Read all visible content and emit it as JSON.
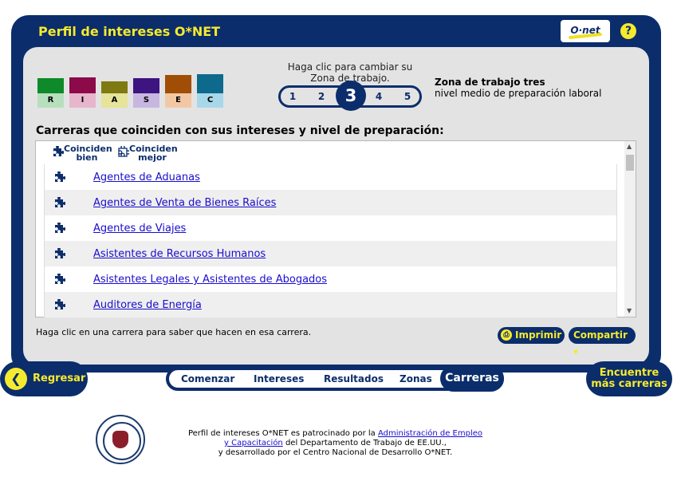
{
  "header": {
    "title": "Perfil de intereses O*NET",
    "logo": "O·net",
    "help": "?"
  },
  "riasec": [
    {
      "label": "R",
      "color": "#0e8a2a",
      "light": "#b7dfbe"
    },
    {
      "label": "I",
      "color": "#8c0a4a",
      "light": "#e7b6cc"
    },
    {
      "label": "A",
      "color": "#7e7a12",
      "light": "#e6e39a"
    },
    {
      "label": "S",
      "color": "#3d1480",
      "light": "#c7b7e0"
    },
    {
      "label": "E",
      "color": "#a04d06",
      "light": "#f2c8a4"
    },
    {
      "label": "C",
      "color": "#0e6a8c",
      "light": "#a8d7ea"
    }
  ],
  "zone": {
    "instruction": "Haga clic para cambiar su Zona de trabajo.",
    "numbers": [
      "1",
      "2",
      "3",
      "4",
      "5"
    ],
    "selected": "3",
    "name": "Zona de trabajo tres",
    "description": "nivel medio de preparación laboral"
  },
  "heading": "Carreras que coinciden con sus intereses y nivel de preparación:",
  "legend": {
    "good": "Coinciden bien",
    "better": "Coinciden mejor"
  },
  "careers": [
    "Agentes de Aduanas",
    "Agentes de Venta de Bienes Raíces",
    "Agentes de Viajes",
    "Asistentes de Recursos Humanos",
    "Asistentes Legales y Asistentes de Abogados",
    "Auditores de Energía"
  ],
  "hint": "Haga clic en una carrera para saber que hacen en esa carrera.",
  "buttons": {
    "print": "Imprimir",
    "share": "Compartir ▾"
  },
  "nav": {
    "back": "Regresar",
    "items": [
      "Comenzar",
      "Intereses",
      "Resultados",
      "Zonas"
    ],
    "selected": "Carreras",
    "find_line1": "Encuentre",
    "find_line2": "más carreras"
  },
  "footer": {
    "text1": "Perfil de intereses O*NET es patrocinado por la ",
    "link1": "Administración de Empleo",
    "link2": "y Capacitación",
    "text2": " del Departamento de Trabajo de EE.UU.,",
    "text3": "y desarrollado por el Centro Nacional de Desarrollo O*NET."
  }
}
